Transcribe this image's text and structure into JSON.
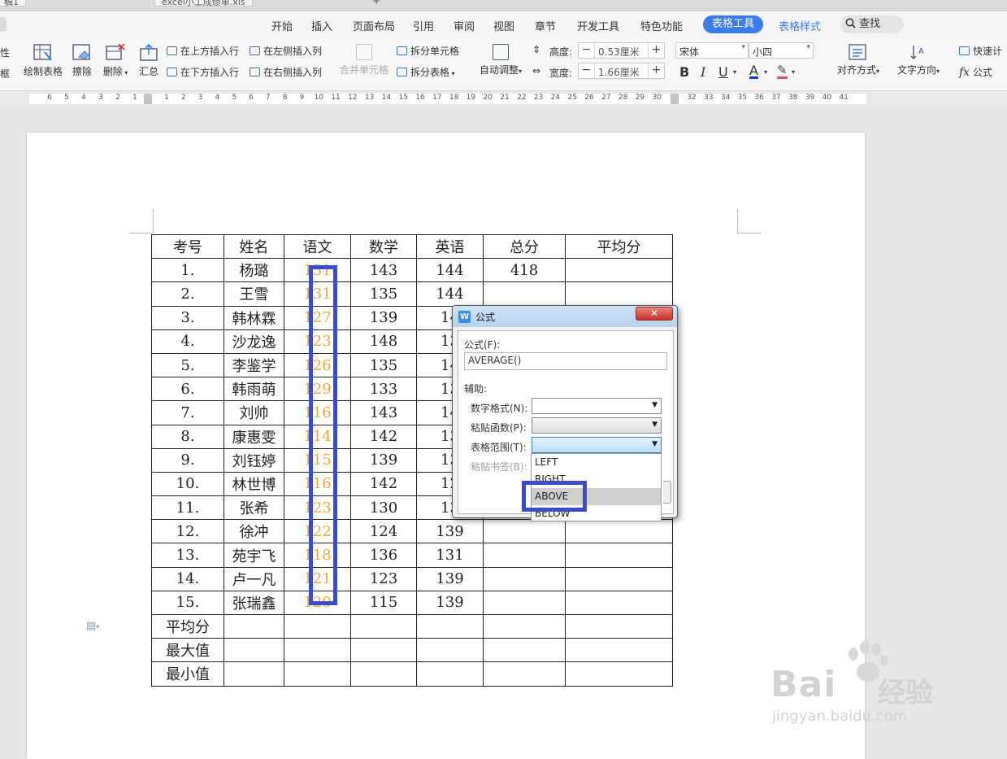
{
  "title_bar": {
    "tabs": [
      "稿1",
      "excel小工成绩单.xls"
    ],
    "new_tab_label": "+"
  },
  "menu": {
    "items": [
      "开始",
      "插入",
      "页面布局",
      "引用",
      "审阅",
      "视图",
      "章节",
      "开发工具",
      "特色功能"
    ],
    "active": "表格工具",
    "after_active": "表格样式",
    "search": "查找"
  },
  "ribbon": {
    "left_partial": [
      "性",
      "框"
    ],
    "draw_table": "绘制表格",
    "erase": "擦除",
    "delete": "删除",
    "summary": "汇总",
    "insert_above": "在上方插入行",
    "insert_below": "在下方插入行",
    "insert_left": "在左侧插入列",
    "insert_right": "在右侧插入列",
    "merge_cells": "合并单元格",
    "split_cells": "拆分单元格",
    "split_table": "拆分表格",
    "auto_fit": "自动调整",
    "height_label": "高度:",
    "height_value": "0.53厘米",
    "width_label": "宽度:",
    "width_value": "1.66厘米",
    "font_name": "宋体",
    "font_size": "小四",
    "bold": "B",
    "italic": "I",
    "underline": "U",
    "font_color": "A",
    "align": "对齐方式",
    "text_direction": "文字方向",
    "quick_calc": "快速计",
    "formula": "公式",
    "fx": "fx"
  },
  "ruler": {
    "left_numbers": [
      "6",
      "5",
      "4",
      "3",
      "2",
      "1"
    ],
    "numbers": [
      "1",
      "2",
      "3",
      "4",
      "5",
      "6",
      "7",
      "8",
      "9",
      "10",
      "11",
      "12",
      "13",
      "14",
      "15",
      "16",
      "17",
      "18",
      "19",
      "20",
      "21",
      "22",
      "23",
      "24",
      "25",
      "26",
      "27",
      "28",
      "29",
      "30"
    ],
    "right_numbers": [
      "32",
      "33",
      "34",
      "35",
      "36",
      "37",
      "38",
      "39",
      "40",
      "41"
    ]
  },
  "table": {
    "headers": [
      "考号",
      "姓名",
      "语文",
      "数学",
      "英语",
      "总分",
      "平均分"
    ],
    "rows": [
      [
        "1.",
        "杨璐",
        "131",
        "143",
        "144",
        "418",
        ""
      ],
      [
        "2.",
        "王雪",
        "131",
        "135",
        "144",
        "",
        ""
      ],
      [
        "3.",
        "韩林霖",
        "127",
        "139",
        "14",
        "",
        ""
      ],
      [
        "4.",
        "沙龙逸",
        "123",
        "148",
        "13",
        "",
        ""
      ],
      [
        "5.",
        "李鉴学",
        "126",
        "135",
        "14",
        "",
        ""
      ],
      [
        "6.",
        "韩雨萌",
        "129",
        "133",
        "13",
        "",
        ""
      ],
      [
        "7.",
        "刘帅",
        "116",
        "143",
        "14",
        "",
        ""
      ],
      [
        "8.",
        "康惠雯",
        "114",
        "142",
        "13",
        "",
        ""
      ],
      [
        "9.",
        "刘钰婷",
        "115",
        "139",
        "13",
        "",
        ""
      ],
      [
        "10.",
        "林世博",
        "116",
        "142",
        "12",
        "",
        ""
      ],
      [
        "11.",
        "张希",
        "123",
        "130",
        "13",
        "",
        ""
      ],
      [
        "12.",
        "徐冲",
        "122",
        "124",
        "139",
        "",
        ""
      ],
      [
        "13.",
        "苑宇飞",
        "118",
        "136",
        "131",
        "",
        ""
      ],
      [
        "14.",
        "卢一凡",
        "121",
        "123",
        "139",
        "",
        ""
      ],
      [
        "15.",
        "张瑞鑫",
        "120",
        "115",
        "139",
        "",
        ""
      ]
    ],
    "footer_rows": [
      "平均分",
      "最大值",
      "最小值"
    ]
  },
  "dialog": {
    "title": "公式",
    "formula_label": "公式(F):",
    "formula_value": "AVERAGE()",
    "helper_label": "辅助:",
    "number_format_label": "数字格式(N):",
    "paste_function_label": "粘贴函数(P):",
    "table_range_label": "表格范围(T):",
    "paste_bookmark_label": "粘贴书签(B):",
    "range_options": [
      "LEFT",
      "RIGHT",
      "ABOVE",
      "BELOW"
    ],
    "highlighted_option": "ABOVE"
  },
  "watermark": {
    "brand": "Bai",
    "brand_cn": "经验",
    "url": "jingyan.baidu.com"
  },
  "colors": {
    "accent": "#3b7de6",
    "highlight_rect": "#3a4dc8",
    "score_text": "#e8a93a"
  }
}
